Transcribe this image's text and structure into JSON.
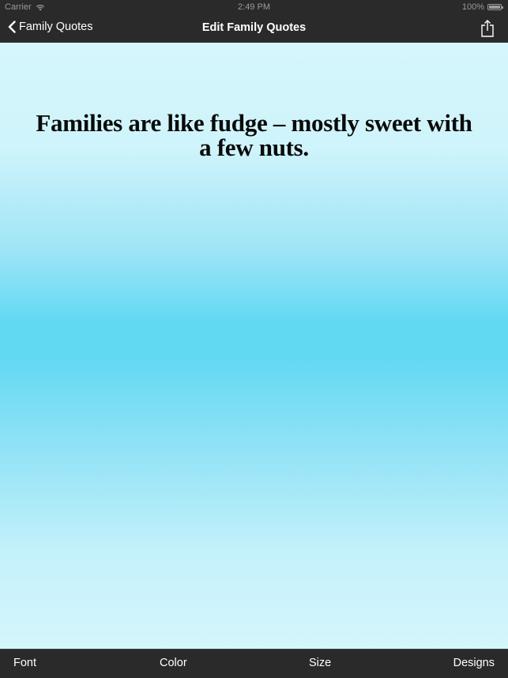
{
  "status_bar": {
    "carrier": "Carrier",
    "time": "2:49 PM",
    "battery": "100%",
    "battery_level": 1.0
  },
  "nav": {
    "back_label": "Family Quotes",
    "title": "Edit Family Quotes",
    "share_icon": "share-icon",
    "back_icon": "chevron-left-icon"
  },
  "quote": {
    "text": "Families are like fudge – mostly sweet with a few nuts."
  },
  "toolbar": {
    "font_label": "Font",
    "color_label": "Color",
    "size_label": "Size",
    "designs_label": "Designs"
  },
  "colors": {
    "bar_background": "#2a2a2a",
    "canvas_light": "#d4f6fc",
    "canvas_mid": "#62d9f3",
    "quote_text": "#0a0a0a"
  }
}
